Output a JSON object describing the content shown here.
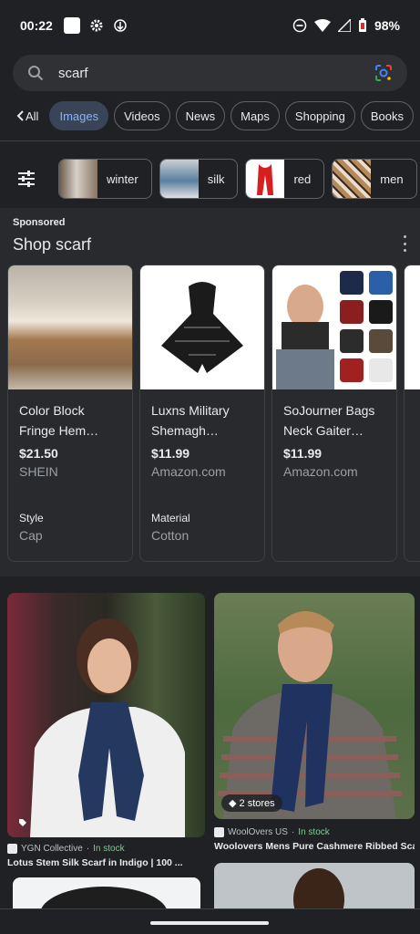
{
  "status_bar": {
    "time": "00:22",
    "battery": "98%"
  },
  "search": {
    "query": "scarf"
  },
  "tabs": {
    "back_label": "All",
    "items": [
      "Images",
      "Videos",
      "News",
      "Maps",
      "Shopping",
      "Books"
    ]
  },
  "related": [
    "winter",
    "silk",
    "red",
    "men"
  ],
  "sponsored": {
    "label": "Sponsored",
    "title": "Shop scarf",
    "products": [
      {
        "name1": "Color Block",
        "name2": "Fringe Hem…",
        "price": "$21.50",
        "store": "SHEIN",
        "attr_key": "Style",
        "attr_val": "Cap"
      },
      {
        "name1": "Luxns Military",
        "name2": "Shemagh…",
        "price": "$11.99",
        "store": "Amazon.com",
        "attr_key": "Material",
        "attr_val": "Cotton"
      },
      {
        "name1": "SoJourner Bags",
        "name2": "Neck Gaiter…",
        "price": "$11.99",
        "store": "Amazon.com",
        "attr_key": "",
        "attr_val": ""
      }
    ]
  },
  "results": [
    {
      "source": "YGN Collective",
      "stock": "In stock",
      "title": "Lotus Stem Silk Scarf in Indigo | 100 ..."
    },
    {
      "source": "WoolOvers US",
      "stock": "In stock",
      "title": "Woolovers Mens Pure Cashmere Ribbed Sca...",
      "badge": "2 stores"
    }
  ],
  "colors": {
    "background": "#202124",
    "accent": "#8ab4f8",
    "in_stock": "#81c995"
  }
}
